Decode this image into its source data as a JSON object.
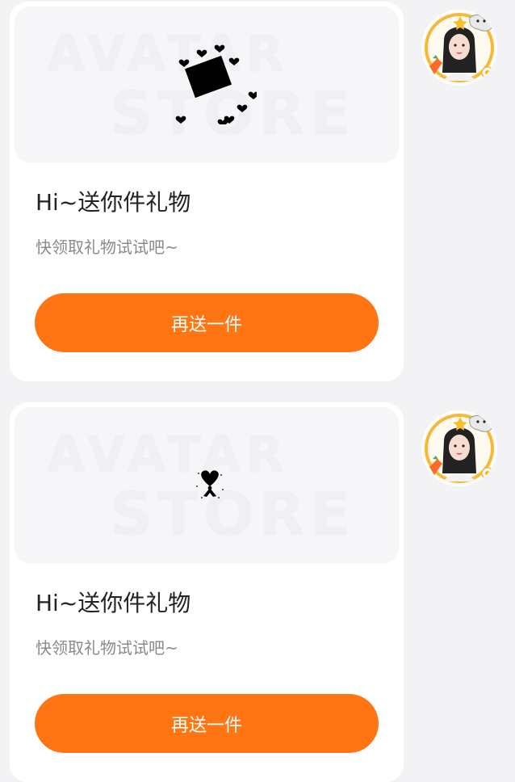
{
  "messages": [
    {
      "banner": {
        "watermark_line1": "AVATAR",
        "watermark_line2": "STORE",
        "gift_icon": "photo-frame-with-hearts-icon"
      },
      "title": "Hi~送你件礼物",
      "subtitle": "快领取礼物试试吧~",
      "button_label": "再送一件",
      "avatar": "girl-avatar-with-sticker-frame"
    },
    {
      "banner": {
        "watermark_line1": "AVATAR",
        "watermark_line2": "STORE",
        "gift_icon": "heart-bow-icon"
      },
      "title": "Hi~送你件礼物",
      "subtitle": "快领取礼物试试吧~",
      "button_label": "再送一件",
      "avatar": "girl-avatar-with-sticker-frame"
    }
  ],
  "colors": {
    "page_background": "#f3f3f5",
    "card_background": "#ffffff",
    "banner_background": "#f6f6f9",
    "accent": "#ff7514",
    "title_text": "#222222",
    "subtitle_text": "#8a8a8e"
  }
}
